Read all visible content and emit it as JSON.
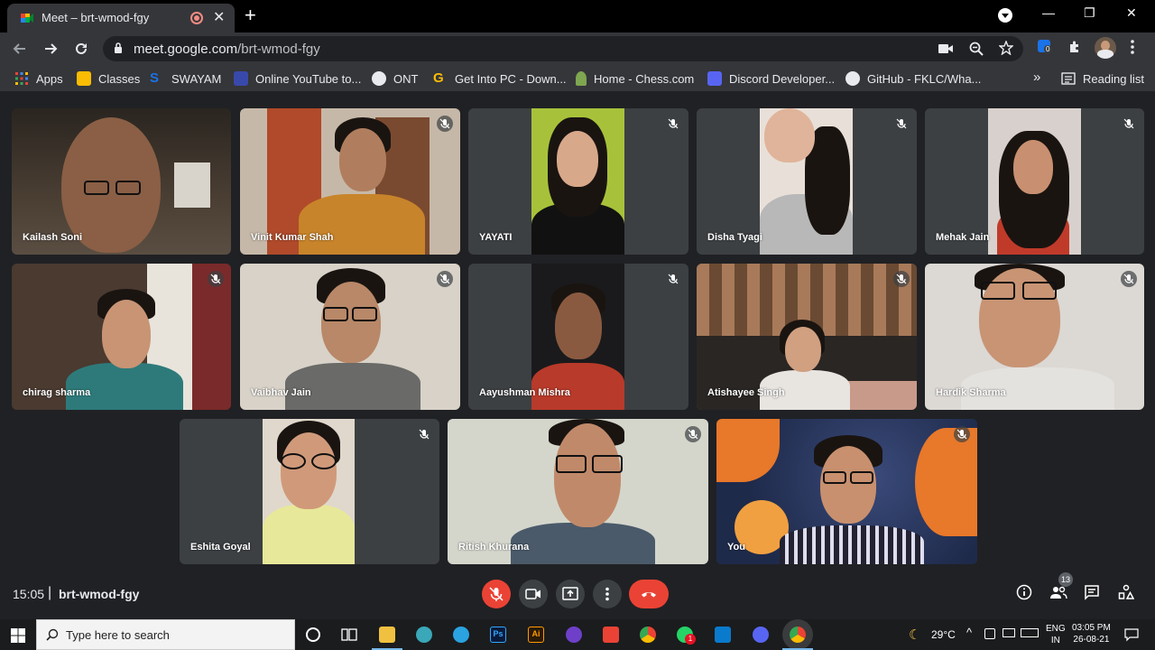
{
  "browser": {
    "tab_title": "Meet – brt-wmod-fgy",
    "url_host": "meet.google.com",
    "url_path": "/brt-wmod-fgy",
    "new_tab_symbol": "+",
    "tab_close_symbol": "✕",
    "minimize_symbol": "—",
    "restore_symbol": "❐",
    "close_symbol": "✕",
    "extension_badge": "0",
    "bookmarks": [
      {
        "label": "Apps",
        "color": "#4285f4"
      },
      {
        "label": "Classes",
        "color": "#fbbc04"
      },
      {
        "label": "SWAYAM",
        "color": "#1a73e8"
      },
      {
        "label": "Online YouTube to...",
        "color": "#3949ab"
      },
      {
        "label": "ONT",
        "color": "#e8eaed"
      },
      {
        "label": "Get Into PC - Down...",
        "color": "#fbbc04"
      },
      {
        "label": "Home - Chess.com",
        "color": "#7fa650"
      },
      {
        "label": "Discord Developer...",
        "color": "#5865f2"
      },
      {
        "label": "GitHub - FKLC/Wha...",
        "color": "#e8eaed"
      }
    ],
    "overflow_symbol": "»",
    "reading_list": "Reading list"
  },
  "meet": {
    "participants": [
      {
        "name": "Kailash Soni",
        "muted": false
      },
      {
        "name": "Vinit Kumar Shah",
        "muted": true
      },
      {
        "name": "YAYATI",
        "muted": true
      },
      {
        "name": "Disha Tyagi",
        "muted": true
      },
      {
        "name": "Mehak Jain",
        "muted": true
      },
      {
        "name": "chirag sharma",
        "muted": true
      },
      {
        "name": "Vaibhav Jain",
        "muted": true
      },
      {
        "name": "Aayushman Mishra",
        "muted": true
      },
      {
        "name": "Atishayee Singh",
        "muted": true
      },
      {
        "name": "Hardik Sharma",
        "muted": true
      },
      {
        "name": "Eshita Goyal",
        "muted": true
      },
      {
        "name": "Ritish Khurana",
        "muted": true
      },
      {
        "name": "You",
        "muted": true
      }
    ],
    "time": "15:05",
    "separator": "|",
    "meeting_code": "brt-wmod-fgy",
    "participant_count": "13"
  },
  "taskbar": {
    "search_placeholder": "Type here to search",
    "temperature": "29°C",
    "lang_top": "ENG",
    "lang_bottom": "IN",
    "clock_time": "03:05 PM",
    "clock_date": "26-08-21",
    "whatsapp_badge": "1"
  }
}
